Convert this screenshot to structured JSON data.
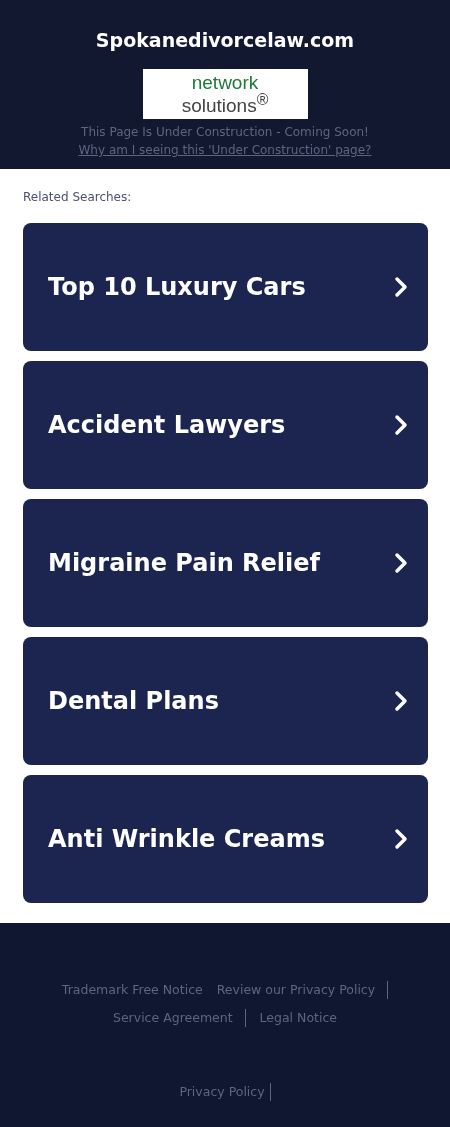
{
  "header": {
    "site_title": "Spokanedivorcelaw.com",
    "logo": {
      "line_1": "network",
      "line_2": "solutions$^{®}$"
    },
    "notice": "This Page Is Under Construction - Coming Soon!",
    "link": "Why am I seeing this 'Under Construction' page?"
  },
  "related": {
    "heading": "Related Searches:",
    "items": [
      {
        "label": "Top 10 Luxury Cars"
      },
      {
        "label": "Accident Lawyers"
      },
      {
        "label": "Migraine Pain Relief"
      },
      {
        "label": "Dental Plans"
      },
      {
        "label": "Anti Wrinkle Creams"
      }
    ]
  },
  "footer": {
    "links": [
      {
        "label": "Trademark Free Notice",
        "divider_after": false
      },
      {
        "label": "Review our Privacy Policy",
        "divider_after": true
      },
      {
        "label": "Service Agreement",
        "divider_after": true
      },
      {
        "label": "Legal Notice",
        "divider_after": false
      }
    ],
    "bottom_link": {
      "label": "Privacy Policy",
      "divider_after": true
    }
  }
}
